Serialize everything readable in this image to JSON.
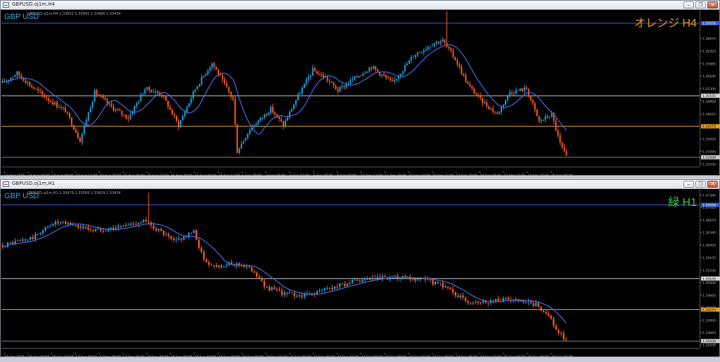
{
  "windows": [
    {
      "title": "GBPUSD.oj1m,H4",
      "symbol": "GBP USD",
      "ohlc": "GBPUSD.oj1m,H4 1.33632 1.33941 1.33486 1.33434",
      "label": "オレンジ H4",
      "label_color": "#f0961e",
      "buttons": {
        "minimize": "‒",
        "restore": "❐",
        "close": "✕"
      },
      "price_ticks": [
        "1.37350",
        "1.36670",
        "1.36320",
        "1.35980",
        "1.35640",
        "1.35300",
        "1.34960",
        "1.34610",
        "1.33930",
        "1.33590",
        "1.33250"
      ],
      "price_range": [
        1.3318,
        1.3742
      ],
      "hlines": [
        {
          "price": "1.37076",
          "color": "#3a5fd0",
          "tag_bg": "#3a5fd0"
        },
        {
          "price": "1.35105",
          "color": "#c8c8c8",
          "tag_bg": "#d8d8d8"
        },
        {
          "price": "1.34275",
          "color": "#e8a020",
          "tag_bg": "#e8a020"
        },
        {
          "price": "1.33434",
          "color": "#808080",
          "tag_bg": "#c8c8c8"
        }
      ],
      "time_labels": [
        "13 Aug 2025",
        "14 Aug 20:00",
        "18 Aug 04:00",
        "19 Aug 12:00",
        "20 Aug 20:00",
        "22 Aug 04:00",
        "25 Aug 12:00",
        "26 Aug 20:00",
        "28 Aug 04:00",
        "29 Aug 12:00",
        "1 Sep 20:00",
        "3 Sep 04:00",
        "4 Sep 12:00",
        "5 Sep 20:00",
        "9 Sep 04:00",
        "10 Sep 12:00",
        "11 Sep 20:00",
        "15 Sep 04:00",
        "16 Sep 12:00",
        "17 Sep 20:00",
        "19 Sep 04:00",
        "22 Sep 12:00",
        "23 Sep 20:00",
        "25 Sep 04:00"
      ],
      "anchors": [
        [
          0,
          1.3545
        ],
        [
          7,
          1.3572
        ],
        [
          14,
          1.3535
        ],
        [
          22,
          1.35
        ],
        [
          30,
          1.347
        ],
        [
          37,
          1.339
        ],
        [
          44,
          1.352
        ],
        [
          52,
          1.348
        ],
        [
          60,
          1.345
        ],
        [
          68,
          1.353
        ],
        [
          76,
          1.3515
        ],
        [
          84,
          1.343
        ],
        [
          92,
          1.353
        ],
        [
          100,
          1.36
        ],
        [
          104,
          1.356
        ],
        [
          110,
          1.35
        ],
        [
          112,
          1.336
        ],
        [
          118,
          1.342
        ],
        [
          128,
          1.3475
        ],
        [
          134,
          1.343
        ],
        [
          141,
          1.351
        ],
        [
          148,
          1.358
        ],
        [
          154,
          1.356
        ],
        [
          160,
          1.3525
        ],
        [
          166,
          1.355
        ],
        [
          176,
          1.359
        ],
        [
          186,
          1.3545
        ],
        [
          196,
          1.362
        ],
        [
          206,
          1.3655
        ],
        [
          210,
          1.366
        ],
        [
          216,
          1.361
        ],
        [
          222,
          1.354
        ],
        [
          228,
          1.35
        ],
        [
          236,
          1.346
        ],
        [
          242,
          1.352
        ],
        [
          250,
          1.353
        ],
        [
          256,
          1.344
        ],
        [
          262,
          1.346
        ],
        [
          266,
          1.338
        ],
        [
          269,
          1.3343
        ]
      ],
      "spike": {
        "index": 212,
        "high": 1.374
      },
      "ma_color": "#4a6ae0"
    },
    {
      "title": "GBPUSD.oj1m,H1",
      "symbol": "GBP USD",
      "ohlc": "GBPUSD.oj1m,H1 1.33479 1.33569 1.33429 1.33434",
      "label": "緑 H1",
      "label_color": "#3cc83c",
      "buttons": {
        "minimize": "‒",
        "restore": "❐",
        "close": "✕"
      },
      "price_ticks": [
        "1.37340",
        "1.37010",
        "1.36670",
        "1.36340",
        "1.36000",
        "1.35670",
        "1.35330",
        "1.35000",
        "1.34660",
        "1.34330",
        "1.33990",
        "1.33660",
        "1.33330"
      ],
      "price_range": [
        1.3325,
        1.3748
      ],
      "hlines": [
        {
          "price": "1.37076",
          "color": "#3a5fd0",
          "tag_bg": "#3a5fd0"
        },
        {
          "price": "1.35105",
          "color": "#c8c8c8",
          "tag_bg": "#d8d8d8"
        },
        {
          "price": "1.34275",
          "color": "#e8a020",
          "tag_bg": "#e8a020"
        },
        {
          "price": "1.33434",
          "color": "#808080",
          "tag_bg": "#c8c8c8"
        }
      ],
      "time_labels": [
        "16 Sep 2025",
        "16 Sep 08:00",
        "16 Sep 16:00",
        "17 Sep 00:00",
        "17 Sep 08:00",
        "17 Sep 16:00",
        "18 Sep 00:00",
        "18 Sep 08:00",
        "18 Sep 16:00",
        "19 Sep 00:00",
        "19 Sep 08:00",
        "19 Sep 16:00",
        "22 Sep 00:00",
        "22 Sep 08:00",
        "22 Sep 16:00",
        "23 Sep 00:00",
        "23 Sep 08:00",
        "23 Sep 16:00",
        "24 Sep 00:00",
        "24 Sep 08:00",
        "24 Sep 16:00",
        "25 Sep 00:00",
        "25 Sep 08:00",
        "25 Sep 16:00"
      ],
      "anchors": [
        [
          0,
          1.36
        ],
        [
          12,
          1.362
        ],
        [
          20,
          1.366
        ],
        [
          28,
          1.3655
        ],
        [
          36,
          1.364
        ],
        [
          46,
          1.3648
        ],
        [
          56,
          1.3665
        ],
        [
          62,
          1.364
        ],
        [
          68,
          1.361
        ],
        [
          76,
          1.3635
        ],
        [
          80,
          1.356
        ],
        [
          84,
          1.3545
        ],
        [
          94,
          1.355
        ],
        [
          100,
          1.353
        ],
        [
          104,
          1.349
        ],
        [
          112,
          1.347
        ],
        [
          120,
          1.3465
        ],
        [
          130,
          1.3485
        ],
        [
          138,
          1.35
        ],
        [
          148,
          1.351
        ],
        [
          158,
          1.3512
        ],
        [
          168,
          1.3505
        ],
        [
          176,
          1.349
        ],
        [
          184,
          1.345
        ],
        [
          192,
          1.345
        ],
        [
          200,
          1.3455
        ],
        [
          206,
          1.3448
        ],
        [
          212,
          1.344
        ],
        [
          216,
          1.342
        ],
        [
          220,
          1.3375
        ],
        [
          224,
          1.3343
        ]
      ],
      "spike": {
        "index": 58,
        "high": 1.374
      },
      "ma_color": "#4a6ae0"
    }
  ]
}
